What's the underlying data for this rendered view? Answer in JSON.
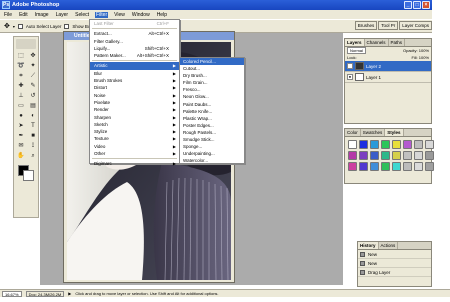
{
  "window": {
    "title": "Adobe Photoshop",
    "icon_text": "Ps"
  },
  "menubar": [
    "File",
    "Edit",
    "Image",
    "Layer",
    "Select",
    "Filter",
    "View",
    "Window",
    "Help"
  ],
  "options_bar": {
    "auto_select": "Auto Select Layer",
    "show_bounding": "Show Bounding Box"
  },
  "palette_well": [
    "Brushes",
    "Tool Pr",
    "Layer Comps"
  ],
  "document": {
    "title": "Untitled-1 @ 16.7% (Layer 2, RGB/8)"
  },
  "filter_menu": {
    "items": [
      {
        "label": "Last Filter",
        "shortcut": "Ctrl+F",
        "disabled": true
      },
      {
        "sep": true
      },
      {
        "label": "Extract...",
        "shortcut": "Alt+Ctrl+X"
      },
      {
        "label": "Filter Gallery..."
      },
      {
        "label": "Liquify...",
        "shortcut": "Shift+Ctrl+X"
      },
      {
        "label": "Pattern Maker...",
        "shortcut": "Alt+Shift+Ctrl+X"
      },
      {
        "sep": true
      },
      {
        "label": "Artistic",
        "submenu": true,
        "highlight": true
      },
      {
        "label": "Blur",
        "submenu": true
      },
      {
        "label": "Brush Strokes",
        "submenu": true
      },
      {
        "label": "Distort",
        "submenu": true
      },
      {
        "label": "Noise",
        "submenu": true
      },
      {
        "label": "Pixelate",
        "submenu": true
      },
      {
        "label": "Render",
        "submenu": true
      },
      {
        "label": "Sharpen",
        "submenu": true
      },
      {
        "label": "Sketch",
        "submenu": true
      },
      {
        "label": "Stylize",
        "submenu": true
      },
      {
        "label": "Texture",
        "submenu": true
      },
      {
        "label": "Video",
        "submenu": true
      },
      {
        "label": "Other",
        "submenu": true
      },
      {
        "sep": true
      },
      {
        "label": "Digimarc",
        "submenu": true
      }
    ]
  },
  "artistic_submenu": [
    "Colored Pencil...",
    "Cutout...",
    "Dry Brush...",
    "Film Grain...",
    "Fresco...",
    "Neon Glow...",
    "Paint Daubs...",
    "Palette Knife...",
    "Plastic Wrap...",
    "Poster Edges...",
    "Rough Pastels...",
    "Smudge Stick...",
    "Sponge...",
    "Underpainting...",
    "Watercolor..."
  ],
  "layers_panel": {
    "tabs": [
      "Layers",
      "Channels",
      "Paths"
    ],
    "blend": "Normal",
    "opacity": "Opacity: 100%",
    "lock": "Lock:",
    "fill": "Fill: 100%",
    "layers": [
      {
        "name": "Layer 2",
        "selected": true
      },
      {
        "name": "Layer 1",
        "selected": false
      }
    ]
  },
  "styles_panel": {
    "tabs": [
      "Color",
      "Swatches",
      "Styles"
    ],
    "colors": [
      "#ffffff",
      "#1c2fe0",
      "#2a9ad8",
      "#2cc65a",
      "#e8e03a",
      "#b45ad0",
      "#bdbdbd",
      "#d8d8d8",
      "#b43aa8",
      "#7a3ec0",
      "#3a5cc8",
      "#2db88a",
      "#d4d04a",
      "#c0c0c0",
      "#d6d6d6",
      "#9a9a9a",
      "#cc3fa0",
      "#5238d0",
      "#3f8ed8",
      "#2fbf5a",
      "#3fd8d0",
      "#bcbcbc",
      "#dadada",
      "#a0a0a0"
    ]
  },
  "history_panel": {
    "tabs": [
      "History",
      "Actions"
    ],
    "items": [
      "New",
      "New",
      "Drag Layer"
    ]
  },
  "statusbar": {
    "zoom": "16.67%",
    "doc": "Doc: 24.3M/26.2M",
    "hint": "Click and drag to move layer or selection. Use Shift and Alt for additional options."
  }
}
